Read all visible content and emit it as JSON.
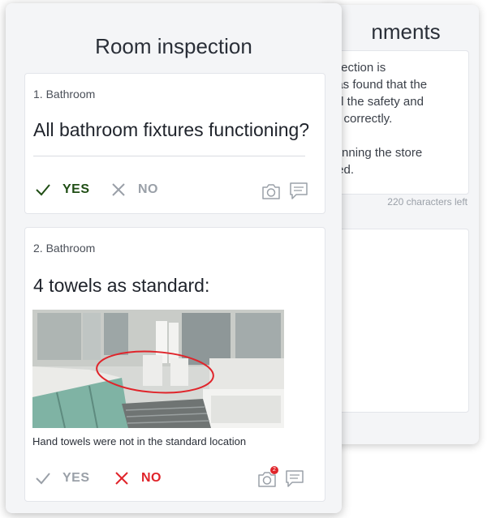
{
  "back_panel": {
    "title": "nments",
    "comment_text": "nspection is\nl was found that the\ng all the safety and\nces correctly.\n\ns running the store\nnised.",
    "chars_left": "220 characters left"
  },
  "inspection": {
    "title": "Room inspection",
    "questions": [
      {
        "label": "1. Bathroom",
        "text": "All bathroom fixtures functioning?",
        "yes_label": "YES",
        "no_label": "NO",
        "selected": "yes"
      },
      {
        "label": "2. Bathroom",
        "text": "4 towels as standard:",
        "caption": "Hand towels were not in the standard location",
        "yes_label": "YES",
        "no_label": "NO",
        "selected": "no",
        "photo_count": "2"
      }
    ]
  },
  "colors": {
    "yes_active": "#1f4d14",
    "no_active": "#e0242a",
    "muted": "#9aa0a8"
  },
  "icons": [
    "check-icon",
    "cross-icon",
    "camera-icon",
    "comment-icon"
  ]
}
